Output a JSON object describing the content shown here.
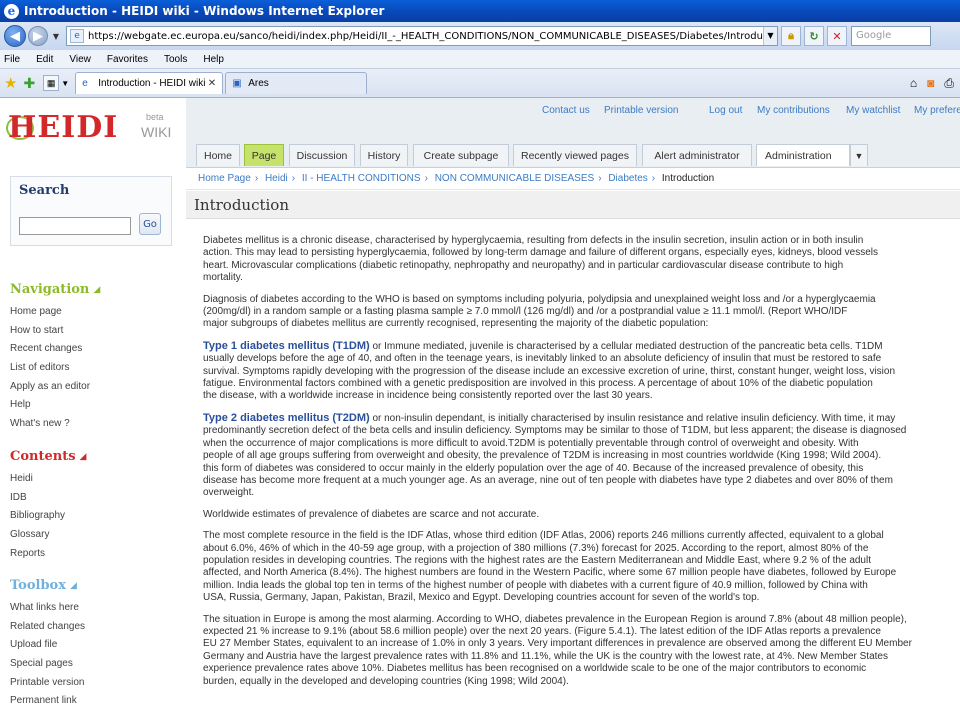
{
  "browser": {
    "title": "Introduction - HEIDI wiki - Windows Internet Explorer",
    "url": "https://webgate.ec.europa.eu/sanco/heidi/index.php/Heidi/II_-_HEALTH_CONDITIONS/NON_COMMUNICABLE_DISEASES/Diabetes/Introduction",
    "search_placeholder": "Google",
    "menu": [
      "File",
      "Edit",
      "View",
      "Favorites",
      "Tools",
      "Help"
    ],
    "tabs": [
      {
        "label": "Introduction - HEIDI wiki",
        "active": true
      },
      {
        "label": "Ares",
        "active": false
      }
    ]
  },
  "site": {
    "logo_text": "HEIDI",
    "logo_wiki": "WIKI",
    "logo_beta": "beta",
    "top_links": [
      "Contact us",
      "Printable version",
      "Log out",
      "My contributions",
      "My watchlist",
      "My preferences"
    ],
    "tabs": [
      "Home",
      "Page",
      "Discussion",
      "History",
      "Create subpage",
      "Recently viewed pages",
      "Alert administrator",
      "Administration"
    ],
    "selected_tab": "Page",
    "breadcrumb": [
      "Home Page",
      "Heidi",
      "II - HEALTH CONDITIONS",
      "NON COMMUNICABLE DISEASES",
      "Diabetes"
    ],
    "breadcrumb_current": "Introduction"
  },
  "sidebar": {
    "search": {
      "title": "Search",
      "go_label": "Go"
    },
    "navigation": {
      "title": "Navigation",
      "items": [
        "Home page",
        "How to start",
        "Recent changes",
        "List of editors",
        "Apply as an editor",
        "Help",
        "What's new ?"
      ]
    },
    "contents": {
      "title": "Contents",
      "items": [
        "Heidi",
        "IDB",
        "Bibliography",
        "Glossary",
        "Reports"
      ]
    },
    "toolbox": {
      "title": "Toolbox",
      "items": [
        "What links here",
        "Related changes",
        "Upload file",
        "Special pages",
        "Printable version",
        "Permanent link"
      ]
    }
  },
  "page": {
    "title": "Introduction",
    "paragraphs": [
      {
        "lines": [
          "Diabetes mellitus is a chronic disease, characterised by hyperglycaemia, resulting from defects in the insulin secretion, insulin action or in both insulin",
          "action. This may lead to persisting hyperglycaemia, followed by long-term damage and failure of different organs, especially eyes, kidneys, blood vessels",
          "heart. Microvascular complications (diabetic retinopathy, nephropathy and neuropathy) and in particular cardiovascular disease contribute to high",
          "mortality."
        ]
      },
      {
        "lines": [
          "Diagnosis of diabetes according to the WHO is based on symptoms including polyuria, polydipsia and unexplained weight loss and /or a hyperglycaemia",
          "(200mg/dl) in a random sample or a fasting plasma sample ≥ 7.0 mmol/l (126 mg/dl) and /or a postprandial value ≥ 11.1 mmol/l. (Report WHO/IDF",
          "major subgroups of diabetes mellitus are currently recognised, representing the majority of the diabetic population:"
        ]
      },
      {
        "subhead": "Type 1 diabetes mellitus (T1DM)",
        "lines": [
          " or Immune mediated, juvenile is characterised by a cellular mediated destruction of the pancreatic beta cells. T1DM",
          "usually develops before the age of 40, and often in the teenage years, is inevitably linked to an absolute deficiency of insulin that must be restored to safe",
          "survival. Symptoms rapidly developing with the progression of the disease include an excessive excretion of urine, thirst, constant hunger, weight loss, vision",
          "fatigue. Environmental factors combined with a genetic predisposition are involved in this process. A percentage of about 10% of the diabetic population",
          "the disease, with a worldwide increase in incidence being consistently reported over the last 30 years."
        ]
      },
      {
        "subhead": "Type 2 diabetes mellitus (T2DM)",
        "lines": [
          " or non-insulin dependant, is initially characterised by insulin resistance and relative insulin deficiency. With time, it may",
          "predominantly secretion defect of the beta cells and insulin deficiency. Symptoms may be similar to those of T1DM, but less apparent; the disease is diagnosed",
          "when the occurrence of major complications is more difficult to avoid.T2DM is potentially preventable through control of overweight and obesity. With",
          "people of all age groups suffering from overweight and obesity, the prevalence of T2DM is increasing in most countries worldwide (King 1998; Wild 2004).",
          "this form of diabetes was considered to occur mainly in the elderly population over the age of 40. Because of the increased prevalence of obesity, this",
          "disease has become more frequent at a much younger age. As an average, nine out of ten people with diabetes have type 2 diabetes and over 80% of them",
          "overweight."
        ]
      },
      {
        "lines": [
          "Worldwide estimates of prevalence of diabetes are scarce and not accurate."
        ]
      },
      {
        "lines": [
          "The most complete resource in the field is the IDF Atlas, whose third edition (IDF Atlas, 2006) reports 246 millions currently affected, equivalent to a global",
          "about 6.0%, 46% of which in the 40-59 age group, with a projection of 380 millions (7.3%) forecast for 2025. According to the report, almost 80% of the",
          "population resides in developing countries. The regions with the highest rates are the Eastern Mediterranean and Middle East, where 9.2 % of the adult",
          "affected, and North America (8.4%). The highest numbers are found in the Western Pacific, where some 67 million people have diabetes, followed by Europe",
          "million. India leads the global top ten in terms of the highest number of people with diabetes with a current figure of 40.9 million, followed by China with",
          "USA, Russia, Germany, Japan, Pakistan, Brazil, Mexico and Egypt. Developing countries account for seven of the world's top."
        ]
      },
      {
        "lines": [
          "The situation in Europe is among the most alarming. According to WHO, diabetes prevalence in the European Region is around 7.8% (about 48 million people),",
          "expected 21 % increase to 9.1% (about 58.6 million people) over the next 20 years. (Figure 5.4.1). The latest edition of the IDF Atlas reports a prevalence",
          "EU 27 Member States, equivalent to an increase of 1.0% in only 3 years. Very important differences in prevalence are observed among the different EU Member",
          "Germany and Austria have the largest prevalence rates with 11.8% and 11.1%, while the UK is the country with the lowest rate, at 4%. New Member States",
          "experience prevalence rates above 10%. Diabetes mellitus has been recognised on a worldwide scale to be one of the major contributors to economic",
          "burden, equally in the developed and developing countries (King 1998; Wild 2004)."
        ]
      }
    ]
  },
  "colors": {
    "titlebar": "#0848b8",
    "logo_red": "#d3282a",
    "nav_green": "#8dba2a",
    "contents_red": "#d3282a",
    "toolbox_blue": "#6fb1dc",
    "link_blue": "#3d7bc4",
    "selected_tab": "#c6e26a",
    "subhead_blue": "#2a4f9a"
  }
}
